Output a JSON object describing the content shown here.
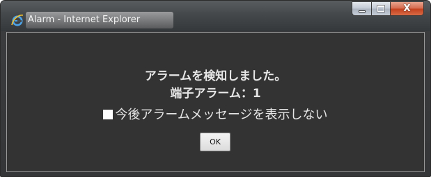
{
  "window": {
    "title": "Alarm - Internet Explorer",
    "browser_icon": "internet-explorer-icon",
    "caption_buttons": {
      "minimize_icon": "minimize-icon",
      "maximize_icon": "maximize-icon",
      "close_icon": "close-icon",
      "close_glyph": "X"
    }
  },
  "dialog": {
    "message_line1": "アラームを検知しました。",
    "message_line2": "端子アラーム：1",
    "suppress_checkbox_checked": false,
    "suppress_label": "今後アラームメッセージを表示しない",
    "ok_label": "OK"
  },
  "colors": {
    "content_background": "#333333",
    "text": "#e6e6e6",
    "close_button": "#c4411f"
  }
}
